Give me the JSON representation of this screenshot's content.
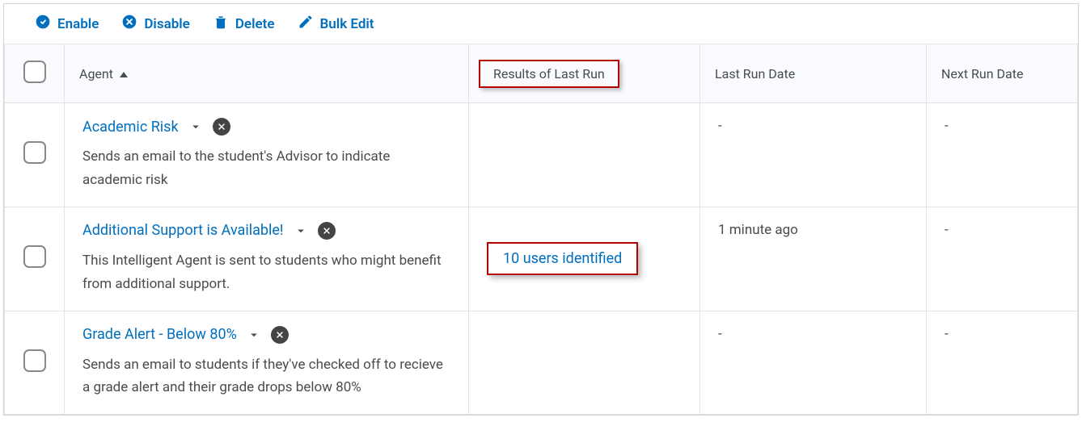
{
  "toolbar": {
    "enable": "Enable",
    "disable": "Disable",
    "delete": "Delete",
    "bulk_edit": "Bulk Edit"
  },
  "columns": {
    "agent": "Agent",
    "results": "Results of Last Run",
    "last_run": "Last Run Date",
    "next_run": "Next Run Date"
  },
  "rows": [
    {
      "title": "Academic Risk",
      "description": "Sends an email to the student's Advisor to indicate academic risk",
      "results": "",
      "last_run": "-",
      "next_run": "-"
    },
    {
      "title": "Additional Support is Available!",
      "description": "This Intelligent Agent is sent to students who might benefit from additional support.",
      "results": "10 users identified",
      "last_run": "1 minute ago",
      "next_run": "-"
    },
    {
      "title": "Grade Alert - Below 80%",
      "description": "Sends an email to students if they've checked off to recieve a grade alert and their grade drops below 80%",
      "results": "",
      "last_run": "-",
      "next_run": "-"
    }
  ]
}
